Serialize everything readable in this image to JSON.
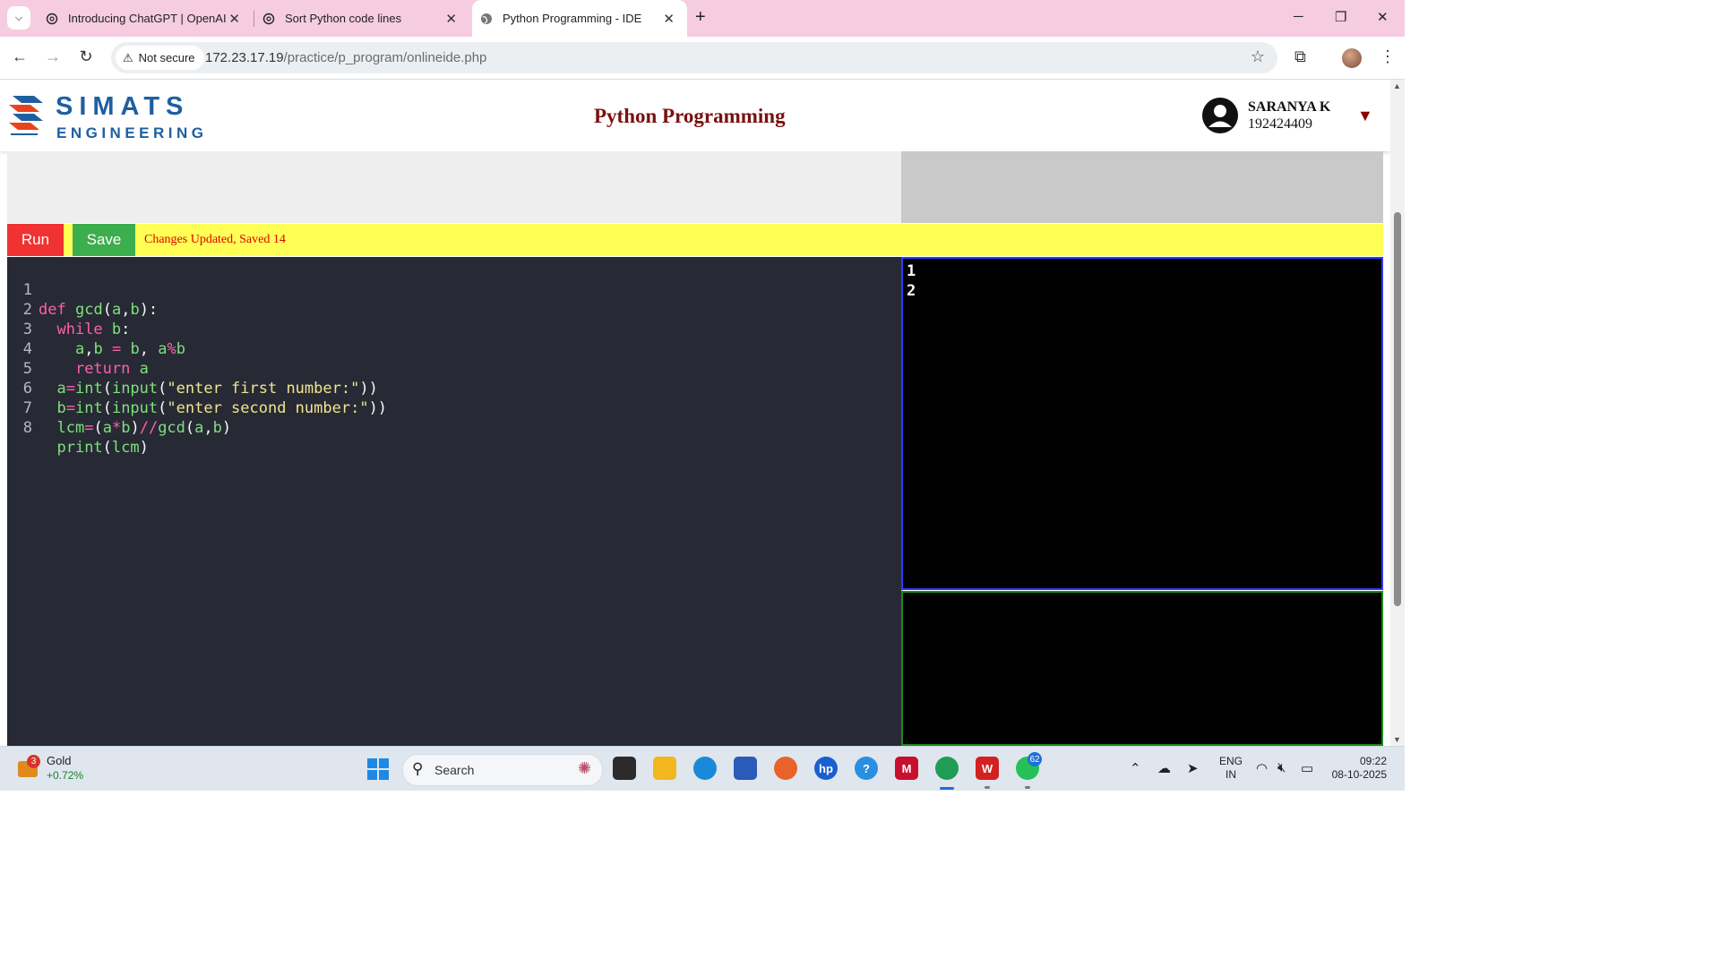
{
  "browser": {
    "tabs": [
      {
        "title": "Introducing ChatGPT | OpenAI",
        "icon": "openai-icon"
      },
      {
        "title": "Sort Python code lines",
        "icon": "openai-icon"
      },
      {
        "title": "Python Programming - IDE",
        "icon": "globe-icon",
        "active": true
      }
    ],
    "security_label": "Not secure",
    "url_host": "172.23.17.19",
    "url_path": "/practice/p_program/onlineide.php"
  },
  "header": {
    "logo_line1": "SIMATS",
    "logo_line2": "ENGINEERING",
    "title": "Python Programming",
    "user_name": "SARANYA K",
    "user_id": "192424409"
  },
  "ide": {
    "run_label": "Run",
    "save_label": "Save",
    "status": "Changes Updated, Saved 14",
    "code_lines": [
      "def gcd(a,b):",
      "  while b:",
      "    a,b = b, a%b",
      "    return a",
      "  a=int(input(\"enter first number:\"))",
      "  b=int(input(\"enter second number:\"))",
      "  lcm=(a*b)//gcd(a,b)",
      "  print(lcm)"
    ],
    "output_lines": [
      "1",
      "2"
    ]
  },
  "taskbar": {
    "widget_name": "Gold",
    "widget_value": "+0.72%",
    "widget_badge": "3",
    "search_placeholder": "Search",
    "whatsapp_badge": "62",
    "lang_line1": "ENG",
    "lang_line2": "IN",
    "time": "09:22",
    "date": "08-10-2025"
  },
  "colors": {
    "tab_strip": "#f6cde0",
    "page_title": "#7a1010",
    "run_button": "#f03232",
    "save_button": "#3cae4d",
    "action_bar": "#ffff55",
    "editor_bg": "#272a35",
    "output_border": "#2a3cff"
  }
}
